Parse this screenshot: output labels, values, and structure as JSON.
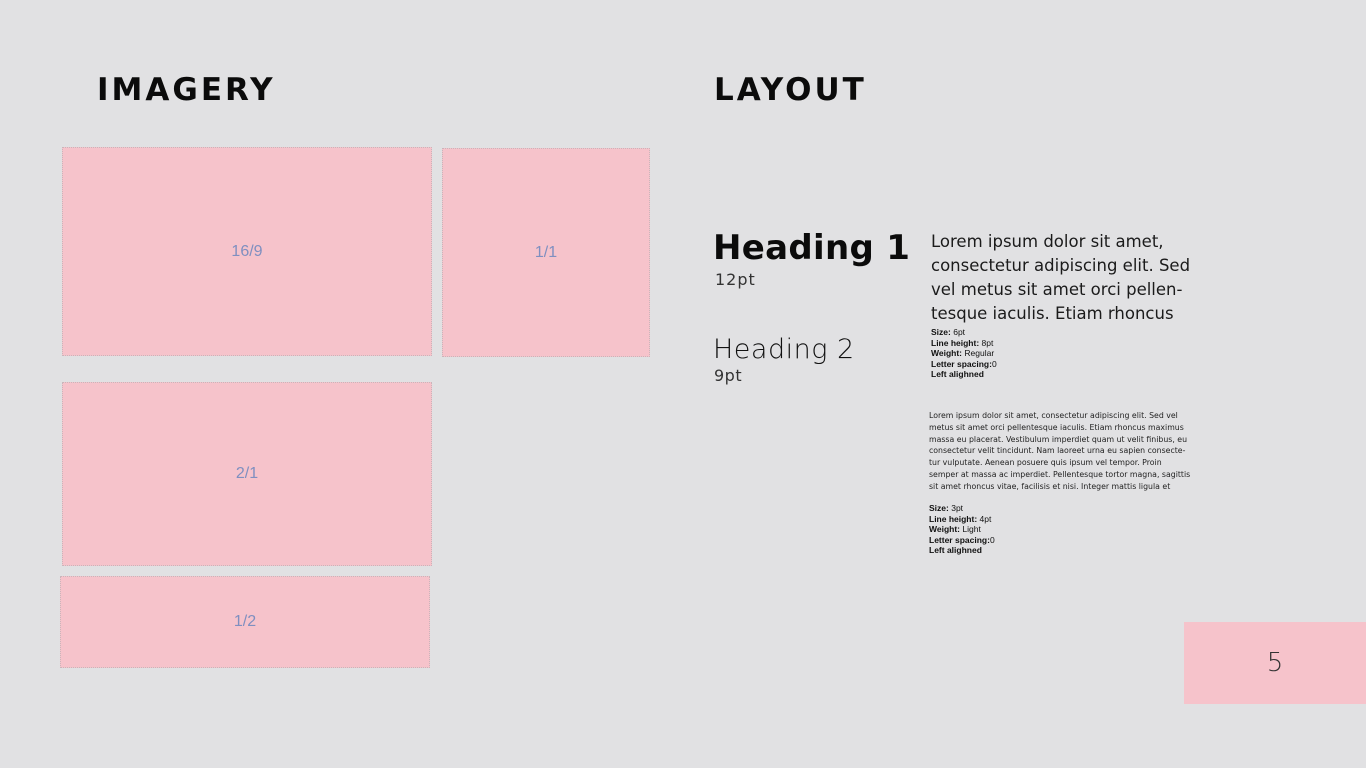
{
  "imagery": {
    "title": "IMAGERY",
    "boxes": [
      {
        "label": "16/9"
      },
      {
        "label": "1/1"
      },
      {
        "label": "2/1"
      },
      {
        "label": "1/2"
      }
    ]
  },
  "layout": {
    "title": "LAYOUT",
    "heading1": {
      "text": "Heading 1",
      "size": "12pt"
    },
    "heading2": {
      "text": "Heading 2",
      "size": "9pt"
    },
    "body_large": {
      "text": "Lorem ipsum dolor sit amet,\nconsectetur adipiscing elit. Sed\nvel metus sit amet orci pellen-\ntesque iaculis. Etiam rhoncus",
      "specs": {
        "size": "6pt",
        "line_height": "8pt",
        "weight": "Regular",
        "letter_spacing": "0",
        "alignment": "Left alighned"
      }
    },
    "body_small": {
      "text": "Lorem ipsum dolor sit amet, consectetur adipiscing elit. Sed vel\nmetus sit amet orci pellentesque iaculis. Etiam rhoncus maximus\nmassa eu placerat. Vestibulum imperdiet quam ut velit finibus, eu\nconsectetur velit tincidunt. Nam laoreet urna eu sapien consecte-\ntur vulputate. Aenean posuere quis ipsum vel tempor. Proin\nsemper at massa ac imperdiet. Pellentesque tortor magna, sagittis\nsit amet rhoncus vitae, facilisis et nisi. Integer mattis ligula et",
      "specs": {
        "size": "3pt",
        "line_height": "4pt",
        "weight": "Light",
        "letter_spacing": "0",
        "alignment": "Left alighned"
      }
    },
    "spec_labels": {
      "size": "Size:",
      "line_height": "Line height:",
      "weight": "Weight:",
      "letter_spacing": "Letter spacing:"
    }
  },
  "page_number": "5",
  "colors": {
    "background": "#e1e1e3",
    "placeholder_fill": "#f6c3cb",
    "placeholder_label": "#7f8fc0"
  }
}
